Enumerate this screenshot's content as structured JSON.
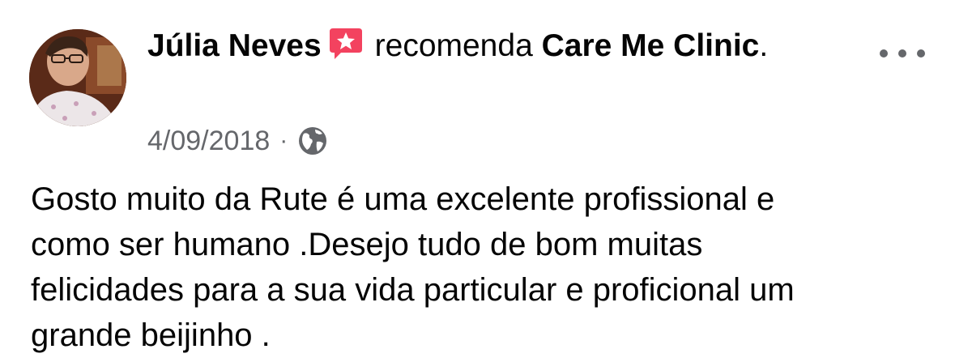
{
  "post": {
    "author": "Júlia Neves",
    "verb": "recomenda",
    "page": "Care Me Clinic",
    "page_suffix": ".",
    "date": "4/09/2018",
    "separator": "·",
    "body": "Gosto muito da Rute é uma excelente profissional e\ncomo ser humano .Desejo tudo de bom muitas\nfelicidades para a sua vida particular e proficional um\ngrande beijinho .",
    "icons": {
      "recommend": "recommendation-star-icon",
      "privacy": "globe-icon",
      "options": "more-options-icon"
    },
    "colors": {
      "recommend_badge": "#f3425f",
      "secondary_text": "#65676b",
      "primary_text": "#050505"
    }
  }
}
